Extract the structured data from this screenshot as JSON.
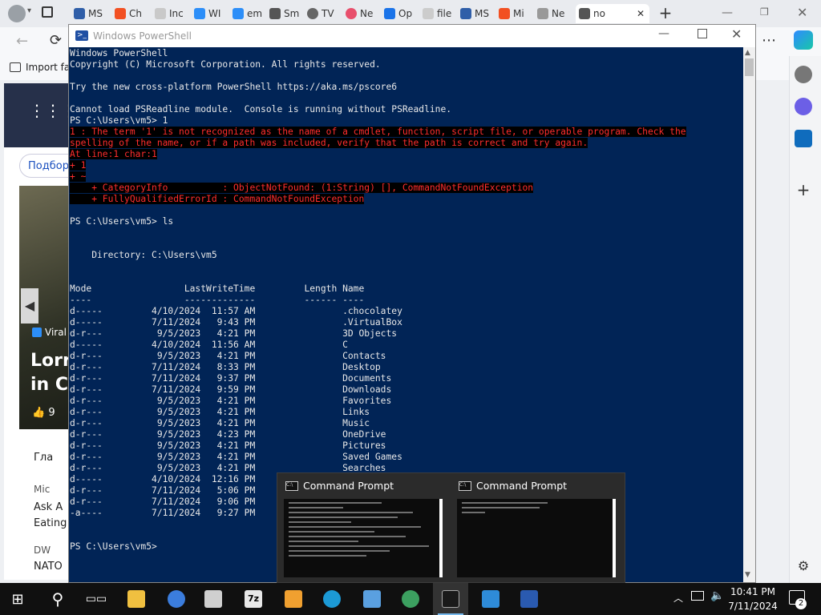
{
  "browser": {
    "tabs": [
      {
        "label": "MS",
        "color": "#2f5ea8"
      },
      {
        "label": "Ch",
        "color": "#f25022"
      },
      {
        "label": "Inc",
        "color": "#888888"
      },
      {
        "label": "WI",
        "color": "#2c8ef8"
      },
      {
        "label": "em",
        "color": "#2c8ef8"
      },
      {
        "label": "Sm",
        "color": "#555555"
      },
      {
        "label": "TV",
        "color": "#666666"
      },
      {
        "label": "Ne",
        "color": "#e84f6c"
      },
      {
        "label": "Op",
        "color": "#1a73e8"
      },
      {
        "label": "file",
        "color": "#888888"
      },
      {
        "label": "MS",
        "color": "#2f5ea8"
      },
      {
        "label": "Mi",
        "color": "#f25022"
      },
      {
        "label": "Ne",
        "color": "#777777"
      },
      {
        "label": "no",
        "color": "#555555"
      }
    ],
    "favorites_import": "Import fa",
    "news": {
      "search_button": "Подбор",
      "hero_source": "Viral",
      "hero_title_line1": "Lorr",
      "hero_title_line2": "in Cl",
      "hero_likes": "9",
      "card1": "Гла",
      "card2_source": "Mic",
      "card2_line1": "Ask A",
      "card2_line2": "Eating",
      "card3_source": "DW",
      "card3_line1": "NATO"
    }
  },
  "powershell": {
    "title": "Windows PowerShell",
    "lines": [
      {
        "text": "Windows PowerShell",
        "err": false
      },
      {
        "text": "Copyright (C) Microsoft Corporation. All rights reserved.",
        "err": false
      },
      {
        "text": "",
        "err": false
      },
      {
        "text": "Try the new cross-platform PowerShell https://aka.ms/pscore6",
        "err": false
      },
      {
        "text": "",
        "err": false
      },
      {
        "text": "Cannot load PSReadline module.  Console is running without PSReadline.",
        "err": false
      },
      {
        "text": "PS C:\\Users\\vm5> 1",
        "err": false
      },
      {
        "text": "1 : The term '1' is not recognized as the name of a cmdlet, function, script file, or operable program. Check the",
        "err": true
      },
      {
        "text": "spelling of the name, or if a path was included, verify that the path is correct and try again.",
        "err": true
      },
      {
        "text": "At line:1 char:1",
        "err": true
      },
      {
        "text": "+ 1",
        "err": true
      },
      {
        "text": "+ ~",
        "err": true
      },
      {
        "text": "    + CategoryInfo          : ObjectNotFound: (1:String) [], CommandNotFoundException",
        "err": true
      },
      {
        "text": "    + FullyQualifiedErrorId : CommandNotFoundException",
        "err": true
      },
      {
        "text": "",
        "err": false
      },
      {
        "text": "PS C:\\Users\\vm5> ls",
        "err": false
      },
      {
        "text": "",
        "err": false
      },
      {
        "text": "",
        "err": false
      },
      {
        "text": "    Directory: C:\\Users\\vm5",
        "err": false
      },
      {
        "text": "",
        "err": false
      },
      {
        "text": "",
        "err": false
      },
      {
        "text": "Mode                 LastWriteTime         Length Name",
        "err": false
      },
      {
        "text": "----                 -------------         ------ ----",
        "err": false
      },
      {
        "text": "d-----         4/10/2024  11:57 AM                .chocolatey",
        "err": false
      },
      {
        "text": "d-----         7/11/2024   9:43 PM                .VirtualBox",
        "err": false
      },
      {
        "text": "d-r---          9/5/2023   4:21 PM                3D Objects",
        "err": false
      },
      {
        "text": "d-----         4/10/2024  11:56 AM                C",
        "err": false
      },
      {
        "text": "d-r---          9/5/2023   4:21 PM                Contacts",
        "err": false
      },
      {
        "text": "d-r---         7/11/2024   8:33 PM                Desktop",
        "err": false
      },
      {
        "text": "d-r---         7/11/2024   9:37 PM                Documents",
        "err": false
      },
      {
        "text": "d-r---         7/11/2024   9:59 PM                Downloads",
        "err": false
      },
      {
        "text": "d-r---          9/5/2023   4:21 PM                Favorites",
        "err": false
      },
      {
        "text": "d-r---          9/5/2023   4:21 PM                Links",
        "err": false
      },
      {
        "text": "d-r---          9/5/2023   4:21 PM                Music",
        "err": false
      },
      {
        "text": "d-r---          9/5/2023   4:23 PM                OneDrive",
        "err": false
      },
      {
        "text": "d-r---          9/5/2023   4:21 PM                Pictures",
        "err": false
      },
      {
        "text": "d-r---          9/5/2023   4:21 PM                Saved Games",
        "err": false
      },
      {
        "text": "d-r---          9/5/2023   4:21 PM                Searches",
        "err": false
      },
      {
        "text": "d-----         4/10/2024  12:16 PM",
        "err": false
      },
      {
        "text": "d-r---         7/11/2024   5:06 PM",
        "err": false
      },
      {
        "text": "d-r---         7/11/2024   9:06 PM",
        "err": false
      },
      {
        "text": "-a----         7/11/2024   9:27 PM",
        "err": false
      },
      {
        "text": "",
        "err": false
      },
      {
        "text": "",
        "err": false
      },
      {
        "text": "PS C:\\Users\\vm5>",
        "err": false
      }
    ]
  },
  "thumbnails": [
    {
      "title": "Command Prompt"
    },
    {
      "title": "Command Prompt"
    }
  ],
  "taskbar": {
    "apps": [
      {
        "name": "file-explorer",
        "color": "#f0c040"
      },
      {
        "name": "chrome",
        "color": "#3b7ddd"
      },
      {
        "name": "virtualbox",
        "color": "#cfcfcf"
      },
      {
        "name": "7zip",
        "color": "#e8e8e8"
      },
      {
        "name": "paint",
        "color": "#f0a030"
      },
      {
        "name": "edge",
        "color": "#1c9ad6"
      },
      {
        "name": "network-app",
        "color": "#5aa0e0"
      },
      {
        "name": "globe-app",
        "color": "#3ca060"
      },
      {
        "name": "command-prompt",
        "color": "#1a1a1a"
      },
      {
        "name": "remote-desktop",
        "color": "#2e8bd8"
      },
      {
        "name": "powershell",
        "color": "#2a5ab0"
      }
    ],
    "clock_time": "10:41 PM",
    "clock_date": "7/11/2024",
    "notification_count": "2"
  }
}
